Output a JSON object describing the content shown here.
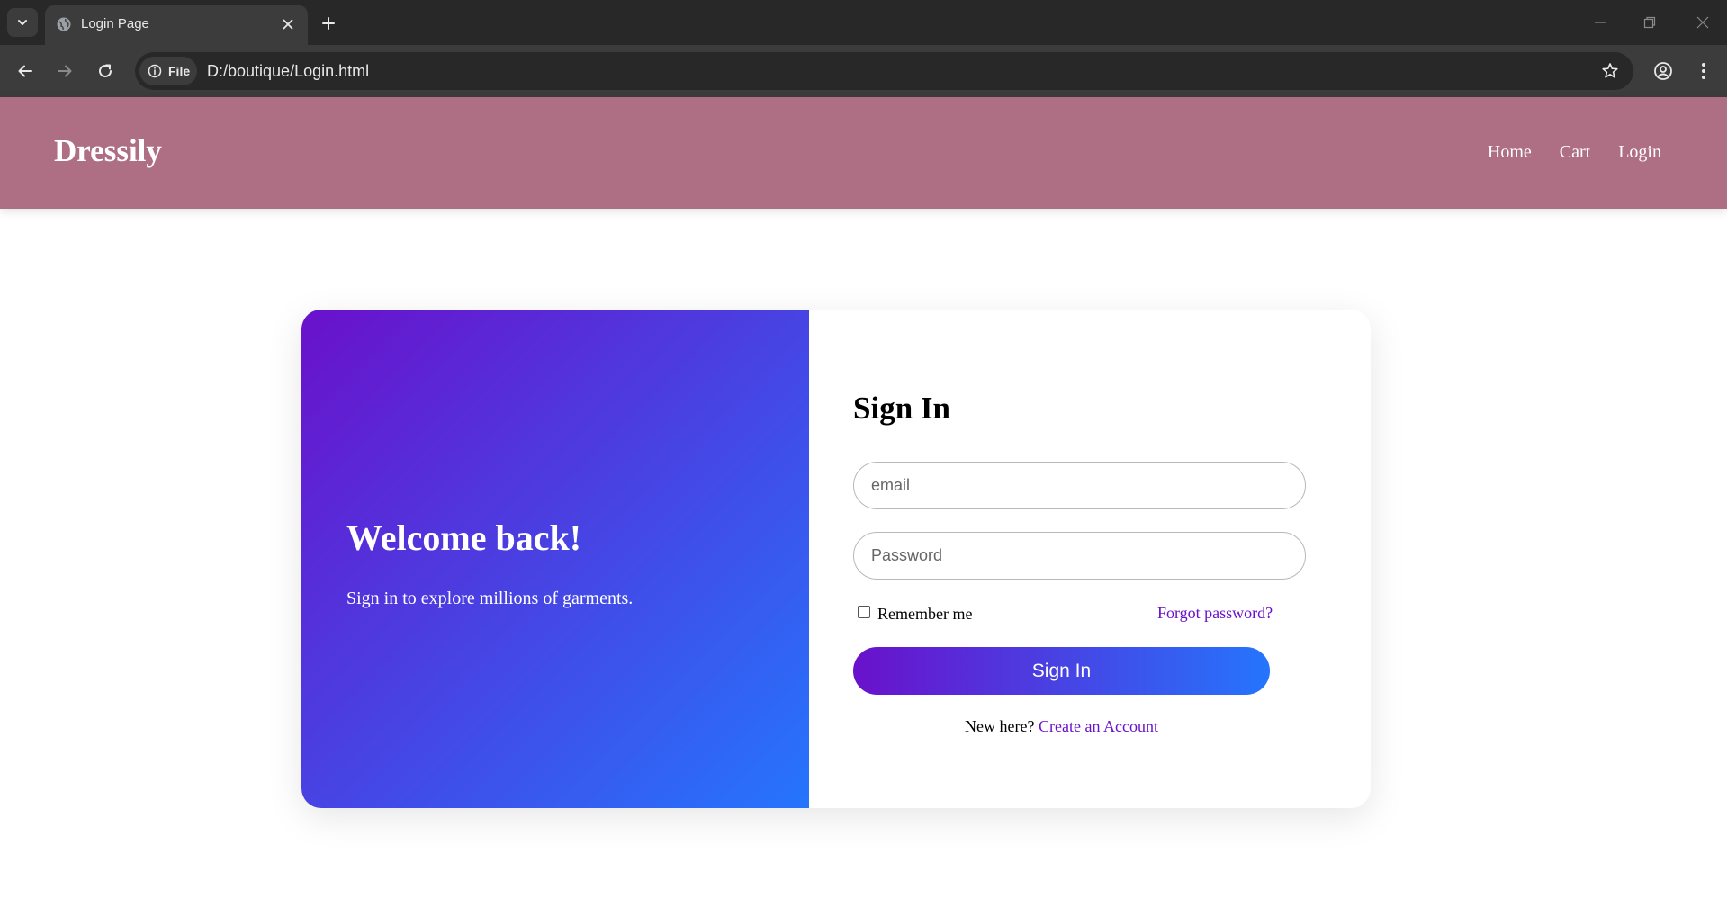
{
  "browser": {
    "tab_title": "Login Page",
    "file_chip_label": "File",
    "url": "D:/boutique/Login.html",
    "icons": {
      "tab_search": "chevron-down-icon",
      "favicon": "globe-icon",
      "close_tab": "close-icon",
      "new_tab": "plus-icon",
      "back": "arrow-left-icon",
      "forward": "arrow-right-icon",
      "reload": "reload-icon",
      "site_info": "info-icon",
      "bookmark": "star-icon",
      "profile": "account-icon",
      "menu": "kebab-menu-icon",
      "minimize": "minimize-icon",
      "restore": "restore-icon",
      "close_window": "close-window-icon"
    }
  },
  "site": {
    "brand": "Dressily",
    "nav": [
      {
        "label": "Home"
      },
      {
        "label": "Cart"
      },
      {
        "label": "Login"
      }
    ],
    "colors": {
      "header_bg": "#ae6f85",
      "gradient_start": "#6a11cb",
      "gradient_end": "#2575fc",
      "link": "#6a11cb"
    }
  },
  "login": {
    "welcome_title": "Welcome back!",
    "welcome_subtitle": "Sign in to explore millions of garments.",
    "heading": "Sign In",
    "email_placeholder": "email",
    "password_placeholder": "Password",
    "remember_label": "Remember me",
    "remember_checked": false,
    "forgot_label": "Forgot password?",
    "submit_label": "Sign In",
    "new_here_text": "New here?",
    "create_account_label": "Create an Account"
  }
}
